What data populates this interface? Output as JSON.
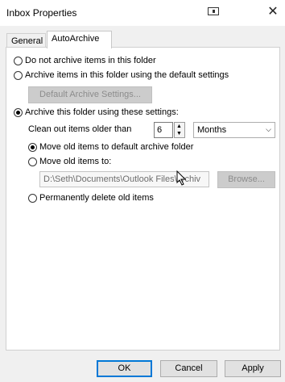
{
  "window": {
    "title": "Inbox Properties"
  },
  "tabs": {
    "general": "General",
    "autoarchive": "AutoArchive"
  },
  "options": {
    "do_not_archive": "Do not archive items in this folder",
    "archive_default": "Archive items in this folder using the default settings",
    "default_settings_button": "Default Archive Settings...",
    "archive_custom": "Archive this folder using these settings:",
    "clean_out_label": "Clean out items older than",
    "age_value": "6",
    "age_unit": "Months",
    "move_default": "Move old items to default archive folder",
    "move_to": "Move old items to:",
    "path_value": "D:\\Seth\\Documents\\Outlook Files\\archiv",
    "browse_button": "Browse...",
    "permanently_delete": "Permanently delete old items"
  },
  "footer": {
    "ok": "OK",
    "cancel": "Cancel",
    "apply": "Apply"
  }
}
